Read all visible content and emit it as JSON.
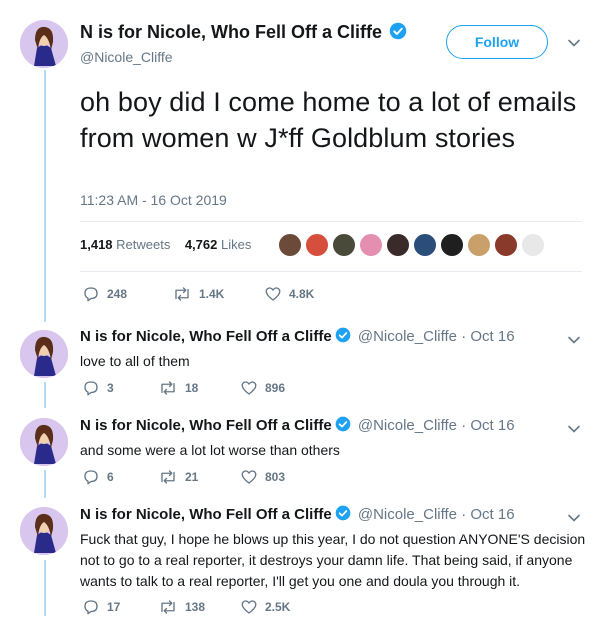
{
  "main_tweet": {
    "author_name": "N is for Nicole, Who Fell Off a Cliffe",
    "handle": "@Nicole_Cliffe",
    "follow_label": "Follow",
    "text": "oh boy did I come home to a lot of emails from women w J*ff Goldblum stories",
    "timestamp": "11:23 AM - 16 Oct 2019",
    "retweets_count": "1,418",
    "retweets_label": "Retweets",
    "likes_count": "4,762",
    "likes_label": "Likes",
    "reply_count": "248",
    "retweet_count_short": "1.4K",
    "like_count_short": "4.8K"
  },
  "replies": [
    {
      "author_name": "N is for Nicole, Who Fell Off a Cliffe",
      "handle": "@Nicole_Cliffe",
      "date": "· Oct 16",
      "text": "love to all of them",
      "reply_count": "3",
      "retweet_count": "18",
      "like_count": "896"
    },
    {
      "author_name": "N is for Nicole, Who Fell Off a Cliffe",
      "handle": "@Nicole_Cliffe",
      "date": "· Oct 16",
      "text": "and some were a lot lot worse than others",
      "reply_count": "6",
      "retweet_count": "21",
      "like_count": "803"
    },
    {
      "author_name": "N is for Nicole, Who Fell Off a Cliffe",
      "handle": "@Nicole_Cliffe",
      "date": "· Oct 16",
      "text": "Fuck that guy, I hope he blows up this year, I do not question ANYONE'S decision not to go to a real reporter, it destroys your damn life. That being said, if anyone wants to talk to a real reporter, I'll get you one and doula you through it.",
      "reply_count": "17",
      "retweet_count": "138",
      "like_count": "2.5K"
    }
  ],
  "colors": {
    "accent": "#1da1f2",
    "muted": "#657786",
    "thread_line": "#b3dcf5",
    "avatar_bg": "#d9c6ee"
  },
  "icons": [
    "verified-badge-icon",
    "chevron-down-icon",
    "reply-icon",
    "retweet-icon",
    "like-icon"
  ]
}
